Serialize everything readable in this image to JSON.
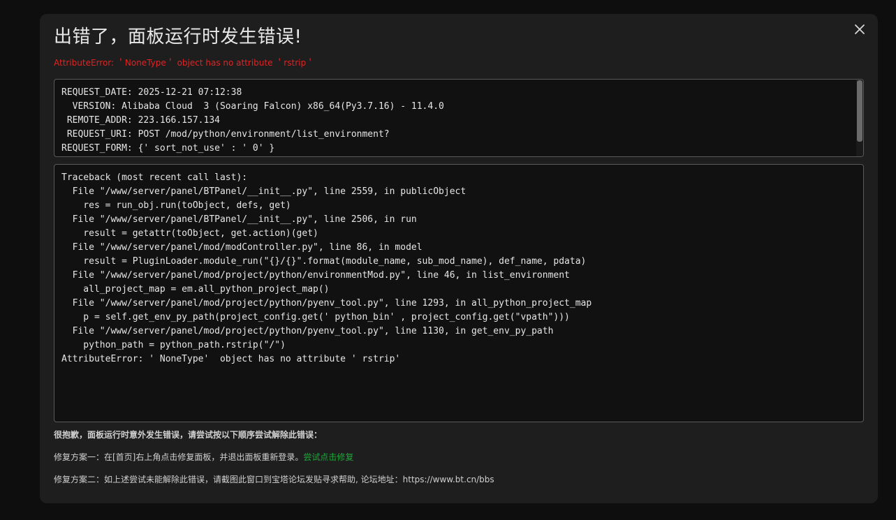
{
  "dialog": {
    "title": "出错了，面板运行时发生错误!",
    "error_message": "AttributeError: ＇NoneType＇ object has no attribute ＇rstrip＇",
    "close_icon": "close-icon"
  },
  "request_info": {
    "lines": [
      "REQUEST_DATE: 2025-12-21 07:12:38",
      "  VERSION: Alibaba Cloud  3 (Soaring Falcon) x86_64(Py3.7.16) - 11.4.0",
      " REMOTE_ADDR: 223.166.157.134",
      " REQUEST_URI: POST /mod/python/environment/list_environment?",
      "REQUEST_FORM: {' sort_not_use' : ' 0' }"
    ]
  },
  "traceback": {
    "lines": [
      "Traceback (most recent call last):",
      "  File \"/www/server/panel/BTPanel/__init__.py\", line 2559, in publicObject",
      "    res = run_obj.run(toObject, defs, get)",
      "  File \"/www/server/panel/BTPanel/__init__.py\", line 2506, in run",
      "    result = getattr(toObject, get.action)(get)",
      "  File \"/www/server/panel/mod/modController.py\", line 86, in model",
      "    result = PluginLoader.module_run(\"{}/{}\".format(module_name, sub_mod_name), def_name, pdata)",
      "  File \"/www/server/panel/mod/project/python/environmentMod.py\", line 46, in list_environment",
      "    all_project_map = em.all_python_project_map()",
      "  File \"/www/server/panel/mod/project/python/pyenv_tool.py\", line 1293, in all_python_project_map",
      "    p = self.get_env_py_path(project_config.get(' python_bin' , project_config.get(\"vpath\")))",
      "  File \"/www/server/panel/mod/project/python/pyenv_tool.py\", line 1130, in get_env_py_path",
      "    python_path = python_path.rstrip(\"/\")",
      "AttributeError: ' NoneType'  object has no attribute ' rstrip'"
    ]
  },
  "help": {
    "heading": "很抱歉，面板运行时意外发生错误，请尝试按以下顺序尝试解除此错误：",
    "fix1_text": "修复方案一：在[首页]右上角点击修复面板，并退出面板重新登录。",
    "fix1_link": "尝试点击修复",
    "fix2_text": "修复方案二：如上述尝试未能解除此错误，请截图此窗口到宝塔论坛发贴寻求帮助, 论坛地址：https://www.bt.cn/bbs"
  },
  "colors": {
    "error_red": "#e02424",
    "link_green": "#20a53a"
  }
}
